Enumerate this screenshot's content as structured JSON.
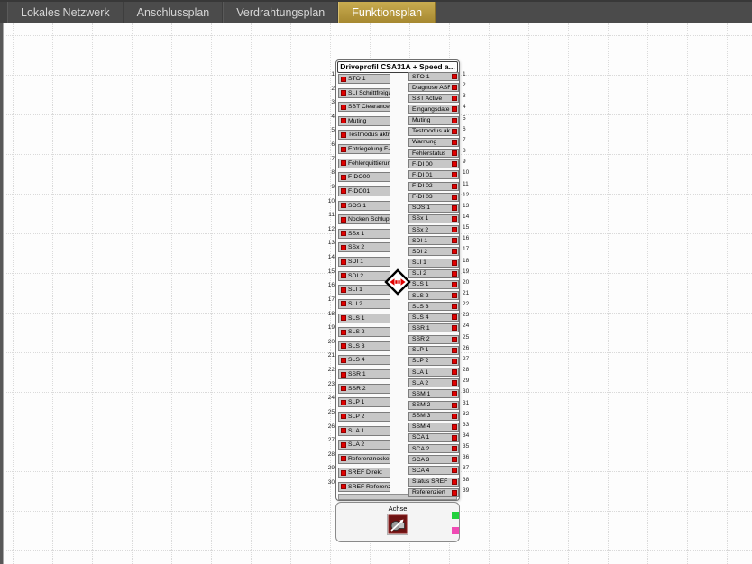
{
  "tabs": {
    "items": [
      {
        "label": "Lokales Netzwerk",
        "active": false
      },
      {
        "label": "Anschlussplan",
        "active": false
      },
      {
        "label": "Verdrahtungsplan",
        "active": false
      },
      {
        "label": "Funktionsplan",
        "active": true
      }
    ],
    "active_color": "#b2953f"
  },
  "function_block": {
    "title": "Driveprofil CSA31A + Speed a...",
    "port_state_color": "#e00000",
    "inputs": [
      "STO 1",
      "SLI Schrittfreigabe",
      "SBT Clearance",
      "Muting",
      "Testmodus aktiv",
      "Entriegelung F-DI",
      "Fehlerquittierung",
      "F-DO00",
      "F-DO01",
      "SOS 1",
      "Nocken Schlupfabgleich",
      "SSx 1",
      "SSx 2",
      "SDI 1",
      "SDI 2",
      "SLI 1",
      "SLI 2",
      "SLS 1",
      "SLS 2",
      "SLS 3",
      "SLS 4",
      "SSR 1",
      "SSR 2",
      "SLP 1",
      "SLP 2",
      "SLA 1",
      "SLA 2",
      "Referenznocken",
      "SREF Direkt",
      "SREF Referenzfahrt"
    ],
    "outputs": [
      "STO 1",
      "Diagnose ASF",
      "SBT Active",
      "Eingangsdaten gültig",
      "Muting",
      "Testmodus aktiv",
      "Warnung",
      "Fehlerstatus",
      "F-DI 00",
      "F-DI 01",
      "F-DI 02",
      "F-DI 03",
      "SOS 1",
      "SSx 1",
      "SSx 2",
      "SDI 1",
      "SDI 2",
      "SLI 1",
      "SLI 2",
      "SLS 1",
      "SLS 2",
      "SLS 3",
      "SLS 4",
      "SSR 1",
      "SSR 2",
      "SLP 1",
      "SLP 2",
      "SLA 1",
      "SLA 2",
      "SSM 1",
      "SSM 2",
      "SSM 3",
      "SSM 4",
      "SCA 1",
      "SCA 2",
      "SCA 3",
      "SCA 4",
      "Status SREF",
      "Referenziert"
    ],
    "axis": {
      "label": "Achse",
      "icon": "motor-axis-icon",
      "ports": [
        {
          "name": "axis-port-green",
          "color": "#22d13e"
        },
        {
          "name": "axis-port-magenta",
          "color": "#f04ab4"
        }
      ]
    }
  },
  "marker": {
    "name": "horizontal-move-cursor",
    "arrow_color": "#e00000"
  }
}
